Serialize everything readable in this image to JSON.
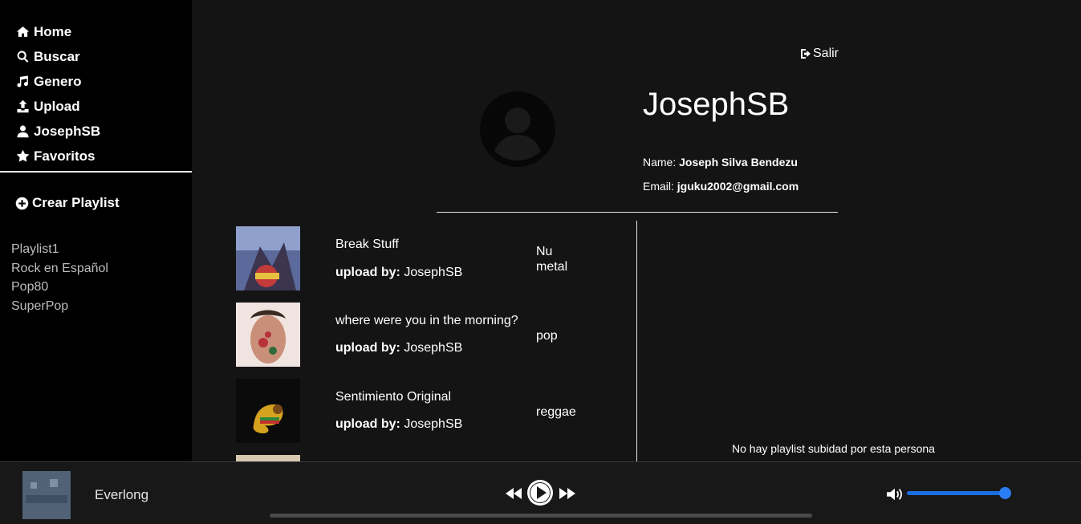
{
  "sidebar": {
    "nav": [
      {
        "label": "Home",
        "icon": "home-icon"
      },
      {
        "label": "Buscar",
        "icon": "search-icon"
      },
      {
        "label": "Genero",
        "icon": "music-note-icon"
      },
      {
        "label": "Upload",
        "icon": "upload-icon"
      },
      {
        "label": "JosephSB",
        "icon": "user-icon"
      },
      {
        "label": "Favoritos",
        "icon": "star-icon"
      }
    ],
    "create_playlist": "Crear Playlist",
    "playlists": [
      "Playlist1",
      "Rock en Español",
      "Pop80",
      "SuperPop"
    ]
  },
  "profile": {
    "logout_label": "Salir",
    "username": "JosephSB",
    "name_label": "Name:",
    "name_value": "Joseph Silva Bendezu",
    "email_label": "Email:",
    "email_value": "jguku2002@gmail.com"
  },
  "songs": [
    {
      "title": "Break Stuff",
      "upload_label": "upload by:",
      "uploader": "JosephSB",
      "genre": "Nu metal"
    },
    {
      "title": "where were you in the morning?",
      "upload_label": "upload by:",
      "uploader": "JosephSB",
      "genre": "pop"
    },
    {
      "title": "Sentimiento Original",
      "upload_label": "upload by:",
      "uploader": "JosephSB",
      "genre": "reggae"
    }
  ],
  "no_playlist_message": "No hay playlist subidad por esta persona",
  "player": {
    "now_playing": "Everlong",
    "progress": 0,
    "volume": 1.0
  },
  "colors": {
    "sidebar_bg": "#000000",
    "main_bg": "#141414",
    "accent": "#1a6fe0"
  }
}
